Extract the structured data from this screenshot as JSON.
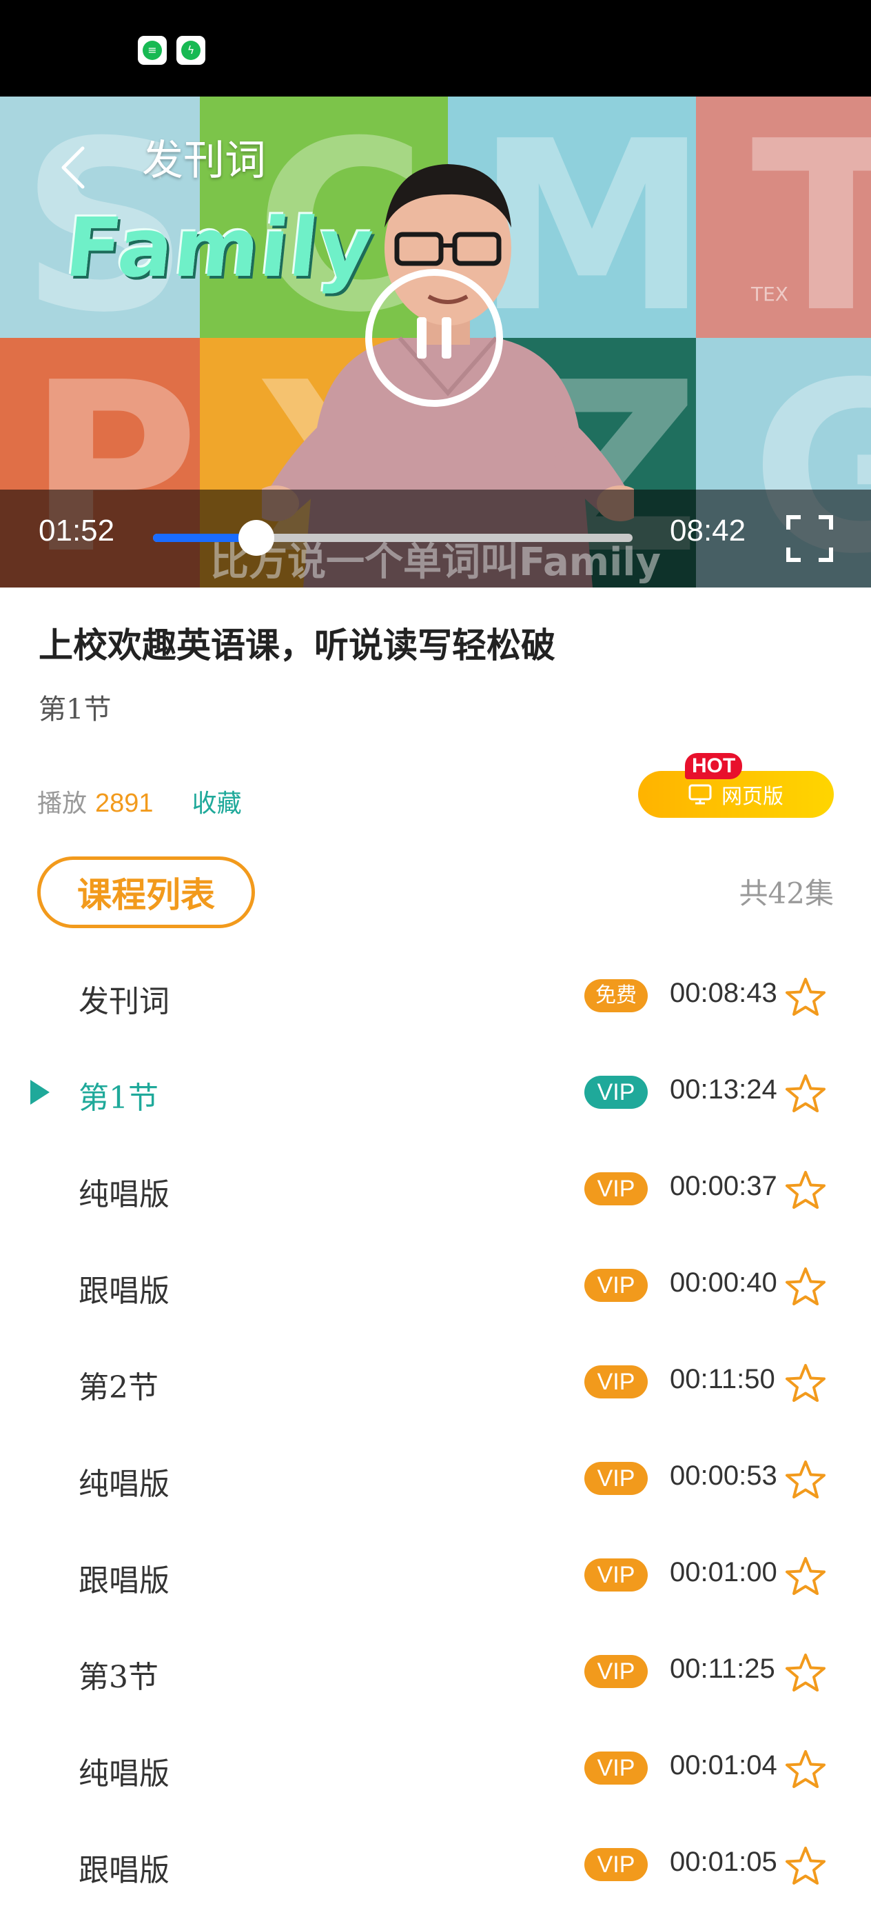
{
  "video": {
    "title": "发刊词",
    "current_time": "01:52",
    "total_time": "08:42",
    "progress": 0.215,
    "subtitle": "比方说一个单词叫Family",
    "overlay_word": "Family",
    "watermark": "TEX"
  },
  "course": {
    "title": "上校欢趣英语课，听说读写轻松破",
    "lesson": "第1节",
    "plays_label": "播放",
    "plays_count": "2891",
    "favorite_label": "收藏",
    "web_button_label": "网页版",
    "hot_badge": "HOT"
  },
  "list_tab": {
    "label": "课程列表",
    "count": "共42集"
  },
  "colors": {
    "accent_orange": "#f29a1c",
    "accent_teal": "#1fa99a",
    "progress_blue": "#1a6cff",
    "hot_red": "#e8102c"
  },
  "episodes": [
    {
      "name": "发刊词",
      "badge": "免费",
      "duration": "00:08:43",
      "active": false
    },
    {
      "name": "第1节",
      "badge": "VIP",
      "duration": "00:13:24",
      "active": true
    },
    {
      "name": "纯唱版",
      "badge": "VIP",
      "duration": "00:00:37",
      "active": false
    },
    {
      "name": "跟唱版",
      "badge": "VIP",
      "duration": "00:00:40",
      "active": false
    },
    {
      "name": "第2节",
      "badge": "VIP",
      "duration": "00:11:50",
      "active": false
    },
    {
      "name": "纯唱版",
      "badge": "VIP",
      "duration": "00:00:53",
      "active": false
    },
    {
      "name": "跟唱版",
      "badge": "VIP",
      "duration": "00:01:00",
      "active": false
    },
    {
      "name": "第3节",
      "badge": "VIP",
      "duration": "00:11:25",
      "active": false
    },
    {
      "name": "纯唱版",
      "badge": "VIP",
      "duration": "00:01:04",
      "active": false
    },
    {
      "name": "跟唱版",
      "badge": "VIP",
      "duration": "00:01:05",
      "active": false
    }
  ]
}
